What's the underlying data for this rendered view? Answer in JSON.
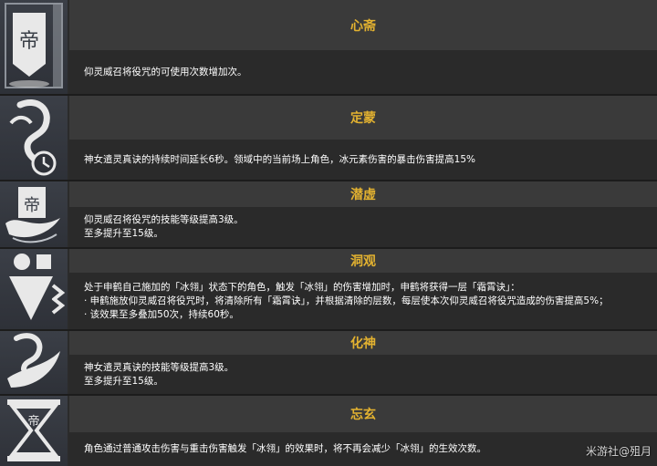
{
  "constellations": [
    {
      "name": "心斋",
      "icon": "banner-sigil-icon",
      "lines": [
        "仰灵威召将役咒的可使用次数增加次。"
      ]
    },
    {
      "name": "定蒙",
      "icon": "crane-timer-icon",
      "lines": [
        "神女遣灵真诀的持续时间延长6秒。领域中的当前场上角色，冰元素伤害的暴击伤害提高15%"
      ]
    },
    {
      "name": "潜虚",
      "icon": "banner-wave-icon",
      "lines": [
        "仰灵威召将役咒的技能等级提高3级。",
        "至多提升至15级。"
      ]
    },
    {
      "name": "洞观",
      "icon": "spear-chevrons-icon",
      "lines": [
        "处于申鹤自己施加的「冰翎」状态下的角色，触发「冰翎」的伤害增加时，申鹤将获得一层「霜霄诀」：",
        "· 申鹤施放仰灵威召将役咒时，将清除所有「霜霄诀」，并根据清除的层数，每层使本次仰灵威召将役咒造成的伤害提高5%；",
        "· 该效果至多叠加50次，持续60秒。"
      ]
    },
    {
      "name": "化神",
      "icon": "crane-swirl-icon",
      "lines": [
        "神女遣灵真诀的技能等级提高3级。",
        "至多提升至15级。"
      ]
    },
    {
      "name": "忘玄",
      "icon": "hourglass-sigil-icon",
      "lines": [
        "角色通过普通攻击伤害与重击伤害触发「冰翎」的效果时，将不再会减少「冰翎」的生效次数。"
      ]
    }
  ],
  "watermark": "米游社@殂月",
  "colors": {
    "title": "#e3b230",
    "title_bg": "#3a3a3a",
    "desc_bg": "#2a2a2a",
    "text": "#ffffff"
  }
}
